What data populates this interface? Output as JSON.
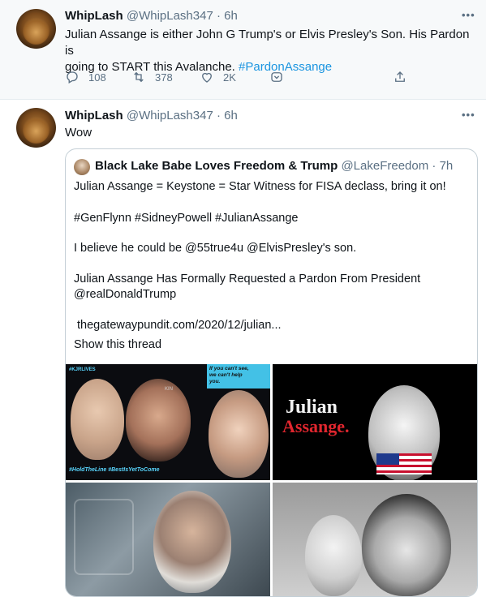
{
  "tweet1": {
    "author_name": "WhipLash",
    "author_handle": "@WhipLash347",
    "time": "· 6h",
    "text_line1": "Julian Assange is either John G Trump's or Elvis Presley's Son. His Pardon is",
    "text_line2": "going to START this Avalanche.",
    "hashtag": "#PardonAssange",
    "more_icon": "•••",
    "replies": "108",
    "retweets": "378",
    "likes": "2K"
  },
  "tweet2": {
    "author_name": "WhipLash",
    "author_handle": "@WhipLash347",
    "time": "· 6h",
    "text": "Wow",
    "more_icon": "•••"
  },
  "quoted": {
    "author_name": "Black Lake Babe Loves Freedom & Trump",
    "author_handle": "@LakeFreedom",
    "time": "· 7h",
    "line1": "Julian Assange = Keystone = Star Witness for FISA declass, bring it on!",
    "line2": "#GenFlynn #SidneyPowell #JulianAssange",
    "line3": "I believe he could be @55true4u @ElvisPresley's son.",
    "line4": "Julian Assange Has Formally Requested a Pardon From President",
    "line5": "@realDonaldTrump",
    "link": "thegatewaypundit.com/2020/12/julian...",
    "show_thread": "Show this thread"
  },
  "images": {
    "img1_top_left": "#KJRLIVES",
    "img1_bottom": "#HoldTheLine #BestIsYetToCome",
    "img1_caption_line1": "If you can't see,",
    "img1_caption_line2": "we can't help",
    "img1_caption_line3": "you.",
    "img2_word1": "Julian",
    "img2_word2": "Assange."
  },
  "colors": {
    "link": "#1b95e0",
    "secondary_text": "#5b7083",
    "hover_bg": "#f7f9fa",
    "border": "#c4cfd6"
  },
  "icons": [
    "reply-icon",
    "retweet-icon",
    "like-icon",
    "share-icon",
    "more-icon"
  ]
}
